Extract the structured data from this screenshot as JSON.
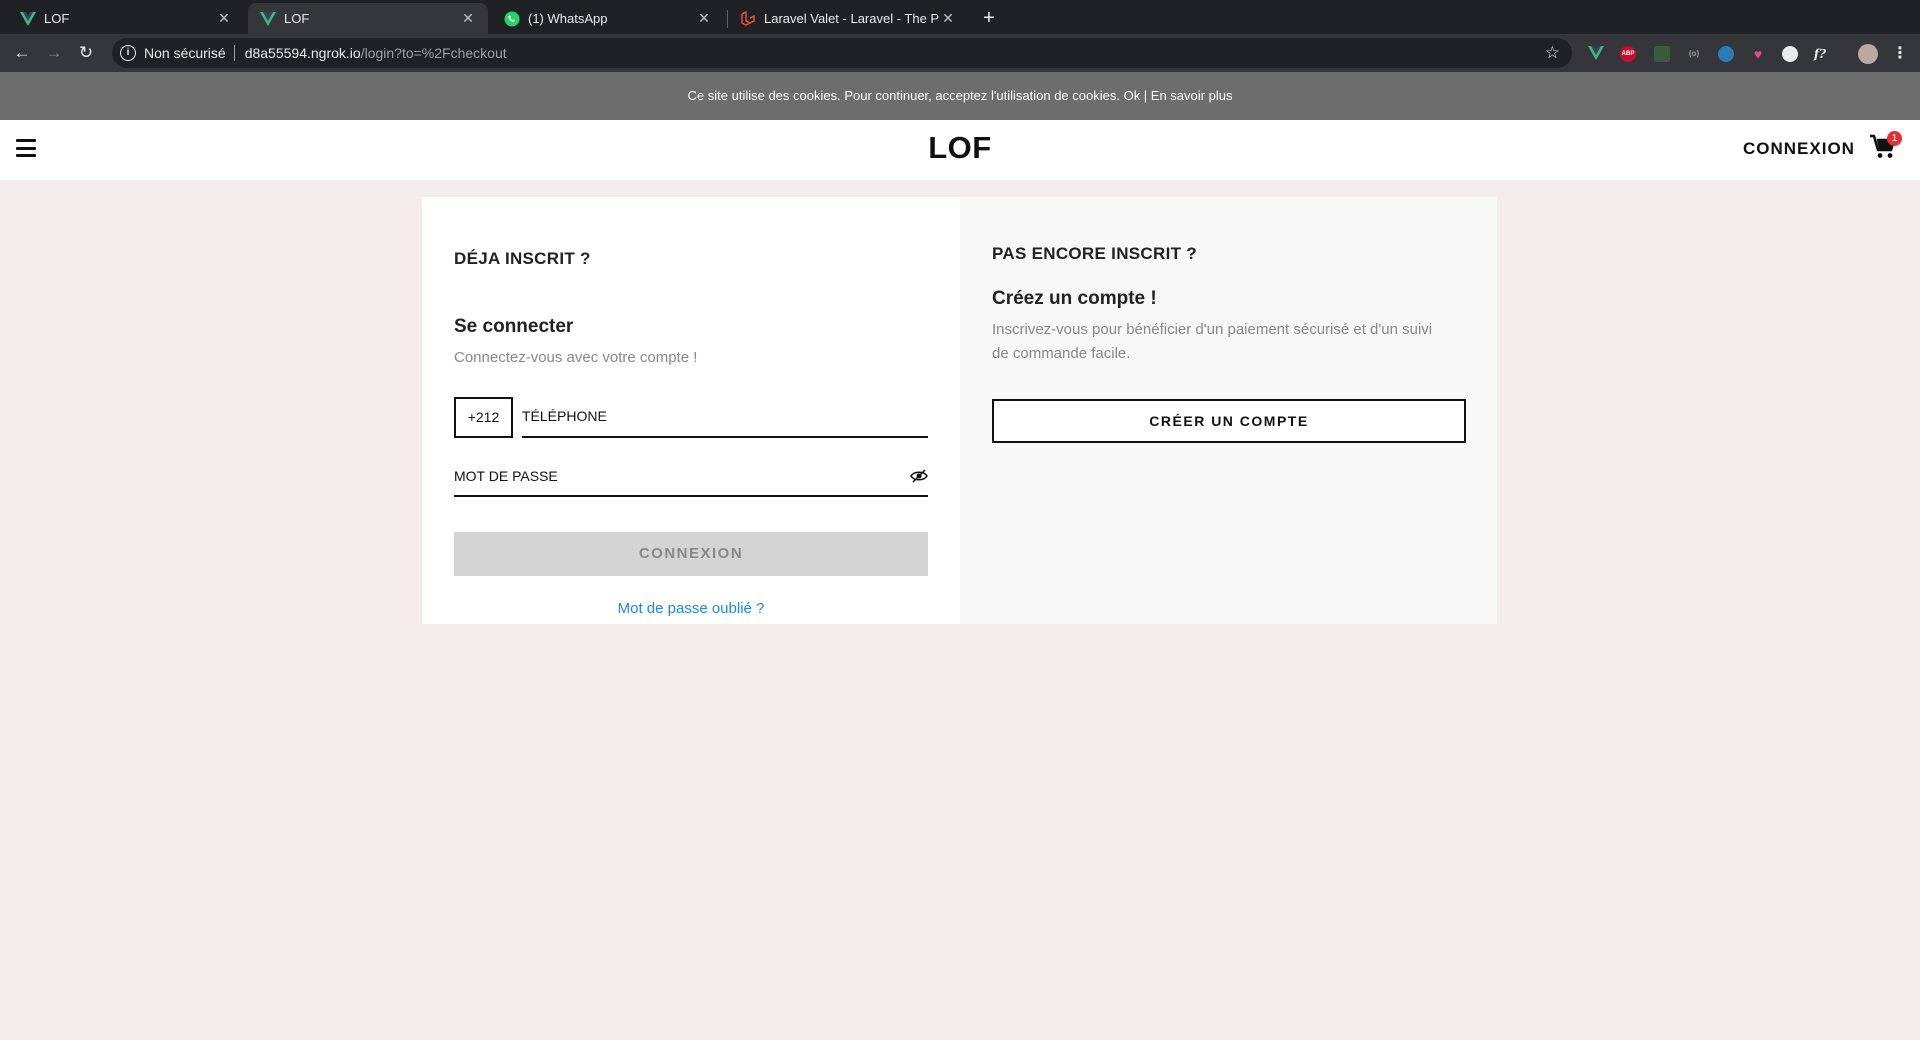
{
  "browser": {
    "tabs": [
      {
        "title": "LOF",
        "icon": "vue-icon"
      },
      {
        "title": "LOF",
        "icon": "vue-icon"
      },
      {
        "title": "(1) WhatsApp",
        "icon": "whatsapp-icon"
      },
      {
        "title": "Laravel Valet - Laravel - The P",
        "icon": "laravel-icon"
      }
    ],
    "address": {
      "security": "Non sécurisé",
      "host": "d8a55594.ngrok.io",
      "path": "/login?to=%2Fcheckout"
    },
    "extensions": [
      {
        "name": "vue-devtools",
        "label": "V",
        "color": "#41b883"
      },
      {
        "name": "adblock-plus",
        "label": "ABP",
        "color": "#c70d2c"
      },
      {
        "name": "extension-2",
        "label": "",
        "color": "#3c5a40"
      },
      {
        "name": "extension-3",
        "label": "(o)",
        "color": "#35363a"
      },
      {
        "name": "extension-4",
        "label": "",
        "color": "#2b7bb9"
      },
      {
        "name": "extension-5",
        "label": "",
        "color": "#e04e8b"
      },
      {
        "name": "extension-6",
        "label": "",
        "color": "#9aa0a6"
      },
      {
        "name": "extension-7",
        "label": "f?",
        "color": "#35363a"
      }
    ]
  },
  "cookie_banner": {
    "text": "Ce site utilise des cookies. Pour continuer, acceptez l'utilisation de cookies. Ok | En savoir plus"
  },
  "header": {
    "logo": "LOF",
    "login": "CONNEXION",
    "cart_count": "1"
  },
  "login": {
    "section_title": "DÉJA INSCRIT ?",
    "title": "Se connecter",
    "subtitle": "Connectez-vous avec votre compte !",
    "country_code": "+212",
    "phone_placeholder": "TÉLÉPHONE",
    "password_placeholder": "MOT DE PASSE",
    "submit": "CONNEXION",
    "forgot": "Mot de passe oublié ?"
  },
  "register": {
    "section_title": "PAS ENCORE INSCRIT ?",
    "title": "Créez un compte !",
    "description": "Inscrivez-vous pour bénéficier d'un paiement sécurisé et d'un suivi de commande facile.",
    "button": "CRÉER UN COMPTE"
  },
  "colors": {
    "page_bg": "#f3eded",
    "link": "#1e88e5",
    "badge": "#e3312f"
  }
}
